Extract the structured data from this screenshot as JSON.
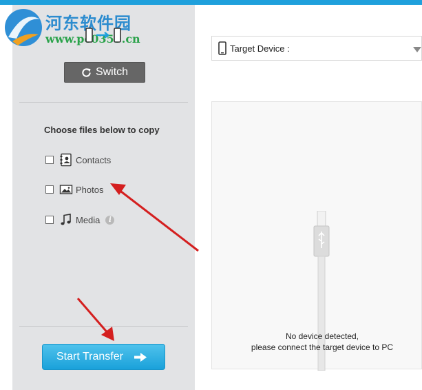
{
  "watermark": {
    "title": "河东软件园",
    "url": "www.pc0359.cn"
  },
  "left_panel": {
    "switch_label": "Switch",
    "choose_title": "Choose files below to copy",
    "items": [
      {
        "label": "Contacts",
        "icon": "contacts-icon",
        "checked": false
      },
      {
        "label": "Photos",
        "icon": "photos-icon",
        "checked": false
      },
      {
        "label": "Media",
        "icon": "music-note-icon",
        "checked": false,
        "info": "i"
      }
    ],
    "start_label": "Start Transfer"
  },
  "target": {
    "label": "Target Device :"
  },
  "device_area": {
    "message_line1": "No device detected,",
    "message_line2": "please connect the target device to PC"
  },
  "colors": {
    "accent": "#1fa0dc",
    "panel": "#e2e3e5",
    "switch_button": "#666666",
    "start_button": "#2eb3e4",
    "annotation_arrows": "#e02020"
  }
}
